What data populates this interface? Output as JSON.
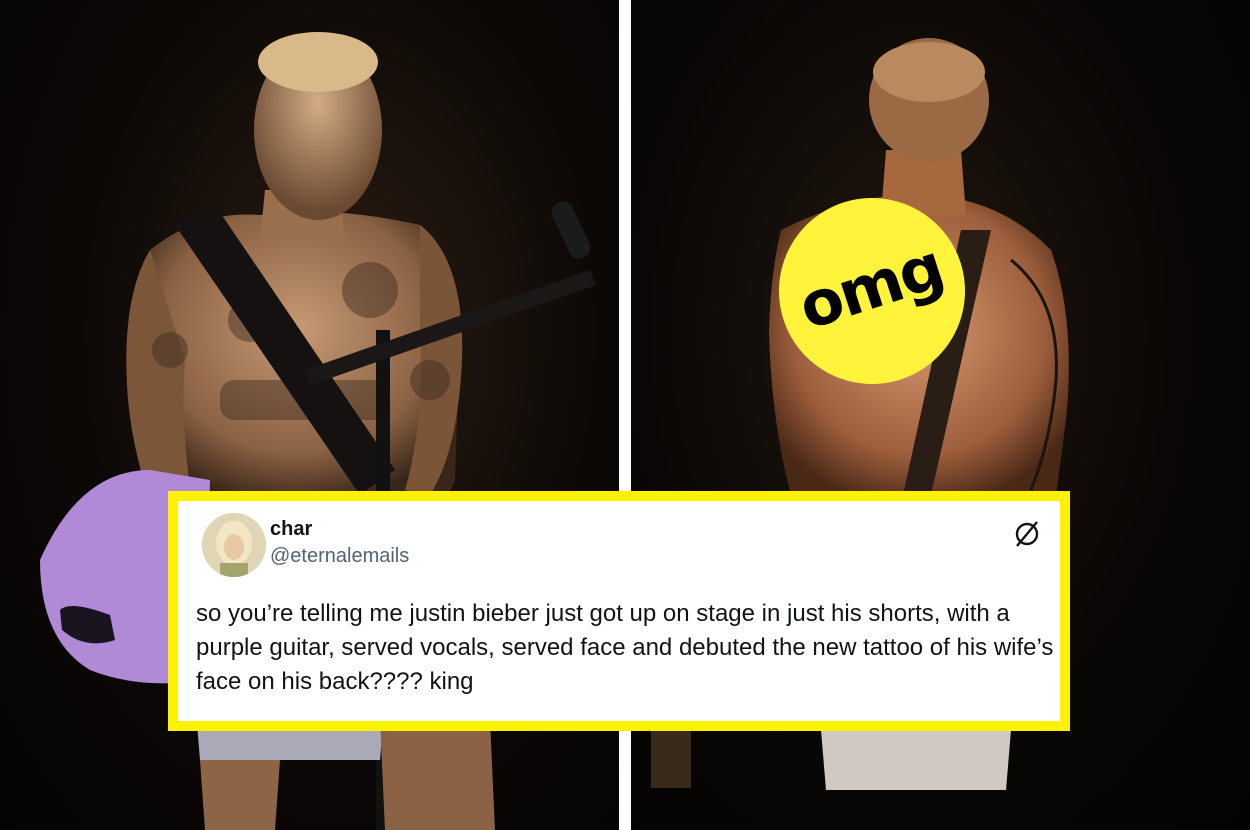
{
  "badge": {
    "label": "omg",
    "color": "#fff33b"
  },
  "tweet": {
    "display_name": "char",
    "handle": "@eternalemails",
    "text": "so you’re telling me justin bieber just got up on stage in just his shorts, with a purple guitar, served vocals, served face and debuted the new tattoo of his wife’s face on his back???? king",
    "border_color": "#fff200",
    "icon": "no-symbol-icon"
  },
  "photos": {
    "left": {
      "guitar_color": "#b08ad6"
    },
    "right": {}
  }
}
